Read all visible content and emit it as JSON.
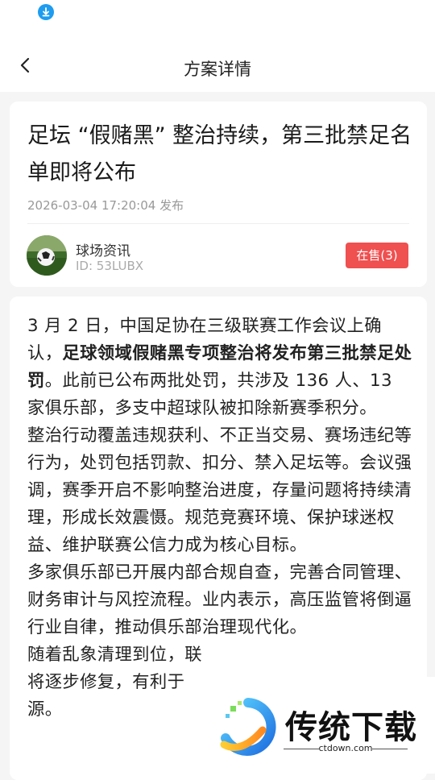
{
  "nav": {
    "title": "方案详情"
  },
  "article": {
    "title": "足坛 “假赌黑” 整治持续，第三批禁足名单即将公布",
    "published": "2026-03-04 17:20:04 发布",
    "author": {
      "name": "球场资讯",
      "id": "ID: 53LUBX"
    },
    "sale_button": "在售(3)",
    "body": {
      "p1_start": "3 月 2 日，中国足协在三级联赛工作会议上确认，",
      "p1_bold": "足球领域假赌黑专项整治将发布第三批禁足处罚",
      "p1_end": "。此前已公布两批处罚，共涉及 136 人、13 家俱乐部，多支中超球队被扣除新赛季积分。",
      "p2": "整治行动覆盖违规获利、不正当交易、赛场违纪等行为，处罚包括罚款、扣分、禁入足坛等。会议强调，赛季开启不影响整治进度，存量问题将持续清理，形成长效震慑。规范竞赛环境、保护球迷权益、维护联赛公信力成为核心目标。",
      "p3": "多家俱乐部已开展内部合规自查，完善合同管理、财务审计与风控流程。业内表示，高压监管将倒逼行业自律，推动俱乐部治理现代化。",
      "p4": "随着乱象清理到位，联",
      "p5": "将逐步修复，有利于",
      "p6": "源。"
    }
  },
  "watermark": {
    "text": "传统下载",
    "url": "ctdown.com"
  },
  "colors": {
    "accent_red": "#ef5050",
    "download_blue": "#1e9cf0"
  }
}
